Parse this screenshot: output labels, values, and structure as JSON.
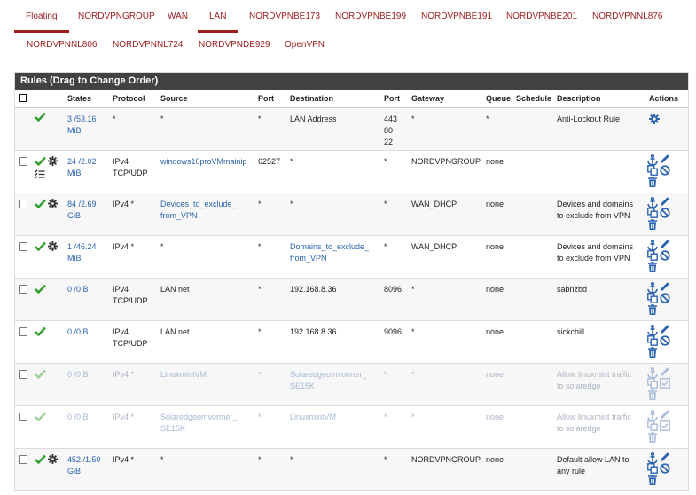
{
  "tabs": [
    {
      "label": "Floating",
      "active": false
    },
    {
      "label": "NORDVPNGROUP",
      "active": false
    },
    {
      "label": "WAN",
      "active": false
    },
    {
      "label": "LAN",
      "active": true
    },
    {
      "label": "NORDVPNBE173",
      "active": false
    },
    {
      "label": "NORDVPNBE199",
      "active": false
    },
    {
      "label": "NORDVPNBE191",
      "active": false
    },
    {
      "label": "NORDVPNBE201",
      "active": false
    },
    {
      "label": "NORDVPNNL876",
      "active": false
    },
    {
      "label": "NORDVPNNL806",
      "active": false
    },
    {
      "label": "NORDVPNNL724",
      "active": false
    },
    {
      "label": "NORDVPNDE929",
      "active": false
    },
    {
      "label": "OpenVPN",
      "active": false
    }
  ],
  "panel": {
    "title": "Rules (Drag to Change Order)"
  },
  "columns": {
    "states": "States",
    "protocol": "Protocol",
    "source": "Source",
    "port": "Port",
    "destination": "Destination",
    "dport": "Port",
    "gateway": "Gateway",
    "queue": "Queue",
    "schedule": "Schedule",
    "description": "Description",
    "actions": "Actions"
  },
  "colors": {
    "accent": "#9c1c1c",
    "link": "#2a63b0",
    "ok": "#2e9e2e",
    "header": "#424242"
  },
  "rules": [
    {
      "states": "3 /53.16 MiB",
      "protocol": "*",
      "source": "*",
      "source_link": false,
      "port": "*",
      "destination": "LAN Address",
      "dest_link": false,
      "dport": "443\n80\n22",
      "gateway": "*",
      "queue": "*",
      "schedule": "",
      "description": "Anti-Lockout Rule",
      "enabled": true,
      "gear": false,
      "list_icon": false,
      "antilockout": true
    },
    {
      "states": "24 /2.02 MiB",
      "protocol": "IPv4\nTCP/UDP",
      "source": "windows10proVMmainip",
      "source_link": true,
      "port": "62527",
      "destination": "*",
      "dest_link": false,
      "dport": "*",
      "gateway": "NORDVPNGROUP",
      "queue": "none",
      "schedule": "",
      "description": "",
      "enabled": true,
      "gear": true,
      "list_icon": true,
      "antilockout": false
    },
    {
      "states": "84 /2.69 GiB",
      "protocol": "IPv4 *",
      "source": "Devices_to_exclude_\nfrom_VPN",
      "source_link": true,
      "port": "*",
      "destination": "*",
      "dest_link": false,
      "dport": "*",
      "gateway": "WAN_DHCP",
      "queue": "none",
      "schedule": "",
      "description": "Devices and domains\nto exclude from VPN",
      "enabled": true,
      "gear": true,
      "list_icon": false,
      "antilockout": false
    },
    {
      "states": "1 /46.24 MiB",
      "protocol": "IPv4 *",
      "source": "*",
      "source_link": false,
      "port": "*",
      "destination": "Domains_to_exclude_\nfrom_VPN",
      "dest_link": true,
      "dport": "*",
      "gateway": "WAN_DHCP",
      "queue": "none",
      "schedule": "",
      "description": "Devices and domains\nto exclude from VPN",
      "enabled": true,
      "gear": true,
      "list_icon": false,
      "antilockout": false
    },
    {
      "states": "0 /0 B",
      "protocol": "IPv4\nTCP/UDP",
      "source": "LAN net",
      "source_link": false,
      "port": "*",
      "destination": "192.168.8.36",
      "dest_link": false,
      "dport": "8096",
      "gateway": "*",
      "queue": "none",
      "schedule": "",
      "description": "sabnzbd",
      "enabled": true,
      "gear": false,
      "list_icon": false,
      "antilockout": false
    },
    {
      "states": "0 /0 B",
      "protocol": "IPv4\nTCP/UDP",
      "source": "LAN net",
      "source_link": false,
      "port": "*",
      "destination": "192.168.8.36",
      "dest_link": false,
      "dport": "9096",
      "gateway": "*",
      "queue": "none",
      "schedule": "",
      "description": "sickchill",
      "enabled": true,
      "gear": false,
      "list_icon": false,
      "antilockout": false
    },
    {
      "states": "0 /0 B",
      "protocol": "IPv4 *",
      "source": "LinuxmintVM",
      "source_link": true,
      "port": "*",
      "destination": "Solaredgeomvormer_\nSE15K",
      "dest_link": true,
      "dport": "*",
      "gateway": "*",
      "queue": "none",
      "schedule": "",
      "description": "Allow linuxmint traffic\nto solaredge",
      "enabled": false,
      "gear": false,
      "list_icon": false,
      "antilockout": false
    },
    {
      "states": "0 /0 B",
      "protocol": "IPv4 *",
      "source": "Solaredgeomvormer_\nSE15K",
      "source_link": true,
      "port": "*",
      "destination": "LinuxmintVM",
      "dest_link": true,
      "dport": "*",
      "gateway": "*",
      "queue": "none",
      "schedule": "",
      "description": "Allow linuxmint traffic\nto solaredge",
      "enabled": false,
      "gear": false,
      "list_icon": false,
      "antilockout": false
    },
    {
      "states": "452 /1.50 GiB",
      "protocol": "IPv4 *",
      "source": "*",
      "source_link": false,
      "port": "*",
      "destination": "*",
      "dest_link": false,
      "dport": "*",
      "gateway": "NORDVPNGROUP",
      "queue": "none",
      "schedule": "",
      "description": "Default allow LAN to\nany rule",
      "enabled": true,
      "gear": true,
      "list_icon": false,
      "antilockout": false
    }
  ]
}
